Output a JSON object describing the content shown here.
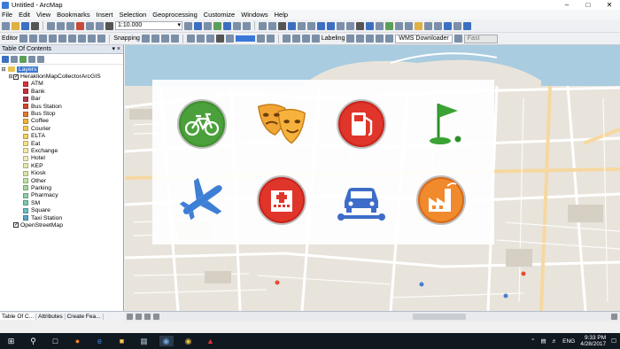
{
  "window": {
    "title": "Untitled - ArcMap"
  },
  "menu": [
    "File",
    "Edit",
    "View",
    "Bookmarks",
    "Insert",
    "Selection",
    "Geoprocessing",
    "Customize",
    "Windows",
    "Help"
  ],
  "toolbar": {
    "scale": "1:10.000",
    "editor_label": "Editor",
    "snapping_label": "Snapping",
    "labeling_label": "Labeling",
    "wms_label": "WMS Downloader",
    "font_value": "Fast"
  },
  "toc": {
    "title": "Table Of Contents",
    "root": "Layers",
    "group": "HeraklionMapCollectorArcGIS",
    "layers": [
      {
        "name": "ATM",
        "color": "#d9363e"
      },
      {
        "name": "Bank",
        "color": "#c8323a"
      },
      {
        "name": "Bar",
        "color": "#b33a52"
      },
      {
        "name": "Bus Station",
        "color": "#d04a2a"
      },
      {
        "name": "Bus Stop",
        "color": "#e07a30"
      },
      {
        "name": "Coffee",
        "color": "#f0b33a"
      },
      {
        "name": "Courier",
        "color": "#f5c856"
      },
      {
        "name": "ELTA",
        "color": "#f3d262"
      },
      {
        "name": "Eat",
        "color": "#f6e08a"
      },
      {
        "name": "Exchange",
        "color": "#f4e8a6"
      },
      {
        "name": "Hotel",
        "color": "#f0ecb8"
      },
      {
        "name": "KEP",
        "color": "#e6e8b0"
      },
      {
        "name": "Kiosk",
        "color": "#d8e6a6"
      },
      {
        "name": "Other",
        "color": "#bfe0a0"
      },
      {
        "name": "Parking",
        "color": "#a6d6a0"
      },
      {
        "name": "Pharmacy",
        "color": "#8fd0a8"
      },
      {
        "name": "SM",
        "color": "#7cc8b4"
      },
      {
        "name": "Square",
        "color": "#6cbcc4"
      },
      {
        "name": "Taxi Station",
        "color": "#5aa6c8"
      }
    ],
    "basemap": "OpenStreetMap"
  },
  "bottom_tabs": [
    "Table Of C...",
    "Attributes",
    "Create Fea..."
  ],
  "poi_icons": [
    "bicycle-icon",
    "theater-masks-icon",
    "fuel-pump-icon",
    "golf-flag-icon",
    "airplane-icon",
    "hospital-icon",
    "car-service-icon",
    "factory-icon"
  ],
  "taskbar": {
    "lang": "ENG",
    "time": "9:33 PM",
    "date": "4/28/2017"
  }
}
